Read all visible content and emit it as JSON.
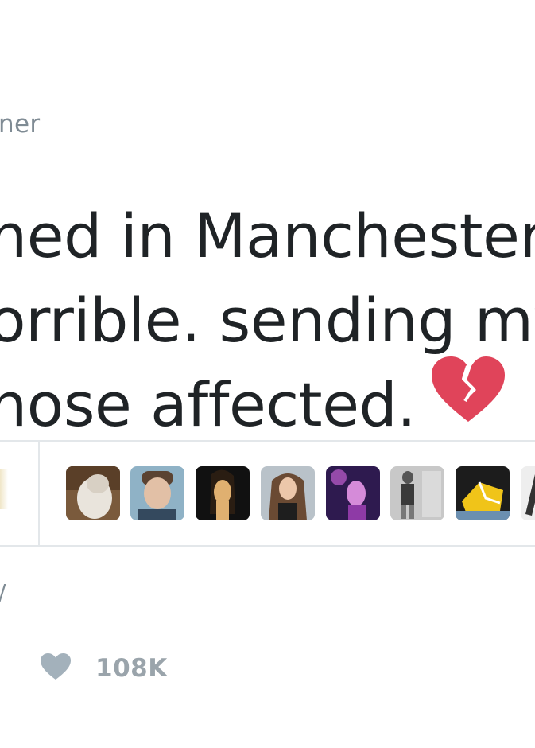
{
  "tweet": {
    "handle_fragment": "ner",
    "text_lines": [
      "ned in Manchester to",
      "orrible. sending my",
      "hose affected."
    ],
    "emoji": "broken-heart-icon"
  },
  "engagement": {
    "likers": [
      {
        "name": "liker-avatar-1",
        "palette": [
          "#7a5a3c",
          "#e9e4dc"
        ]
      },
      {
        "name": "liker-avatar-2",
        "palette": [
          "#8fb2c6",
          "#e2c0a6"
        ]
      },
      {
        "name": "liker-avatar-3",
        "palette": [
          "#111111",
          "#e0b070"
        ]
      },
      {
        "name": "liker-avatar-4",
        "palette": [
          "#b9c2c9",
          "#6a4a33"
        ]
      },
      {
        "name": "liker-avatar-5",
        "palette": [
          "#2e1a4f",
          "#c25fd0"
        ]
      },
      {
        "name": "liker-avatar-6",
        "palette": [
          "#c8c8c8",
          "#3a3a3a"
        ]
      },
      {
        "name": "liker-avatar-7",
        "palette": [
          "#1c1c1c",
          "#f0c419"
        ]
      },
      {
        "name": "liker-avatar-8",
        "palette": [
          "#eeeeee",
          "#333333"
        ]
      }
    ],
    "like_icon": "heart-icon",
    "like_count": "108K",
    "truncated_mark": "/"
  },
  "colors": {
    "text": "#1f2326",
    "muted": "#7f8b94",
    "divider": "#e3e7ea",
    "broken_heart": "#e0445a"
  }
}
